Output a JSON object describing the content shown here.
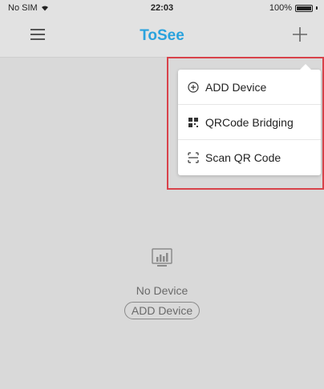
{
  "status_bar": {
    "carrier": "No SIM",
    "time": "22:03",
    "battery": "100%"
  },
  "nav": {
    "title": "ToSee"
  },
  "dropdown": {
    "items": [
      {
        "label": "ADD Device",
        "icon": "plus-circle-icon"
      },
      {
        "label": "QRCode Bridging",
        "icon": "qr-bridge-icon"
      },
      {
        "label": "Scan QR Code",
        "icon": "scan-icon"
      }
    ]
  },
  "empty_state": {
    "message": "No Device",
    "button_label": "ADD Device",
    "icon": "monitor-chart-icon"
  },
  "colors": {
    "title": "#2aa2dd",
    "highlight_border": "#d8424a",
    "background": "#d9d9d9"
  }
}
